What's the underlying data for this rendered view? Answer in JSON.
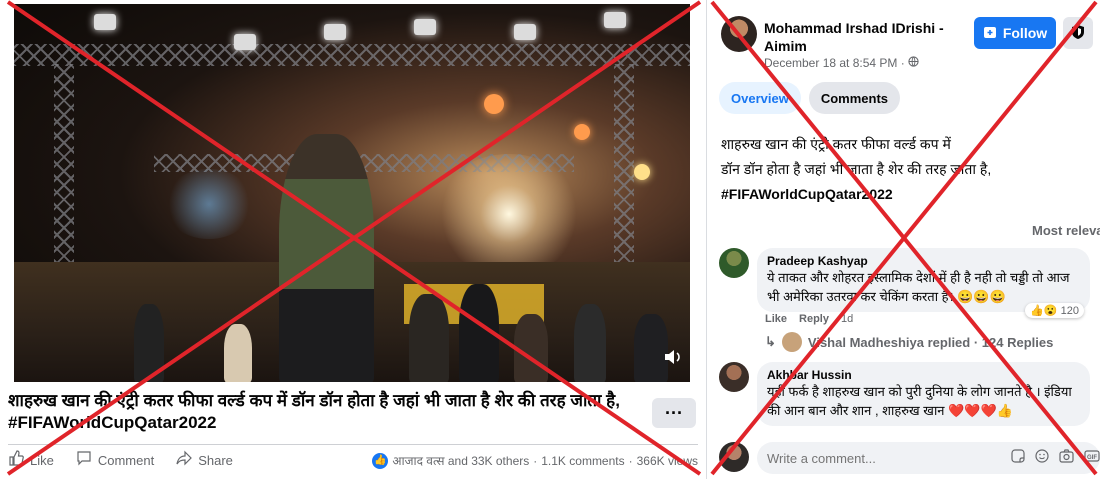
{
  "video_post": {
    "title": "शाहरुख खान की एंट्री कतर फीफा वर्ल्ड कप में डॉन डॉन होता है जहां भी जाता है शेर की तरह जाता है, #FIFAWorldCupQatar2022",
    "more_label": "···",
    "actions": {
      "like": "Like",
      "comment": "Comment",
      "share": "Share"
    },
    "stats": {
      "reactions": "आजाद वत्स and 33K others",
      "separator": "·",
      "comments": "1.1K comments",
      "views": "366K views"
    }
  },
  "post_detail": {
    "author": "Mohammad Irshad IDrishi - Aimim",
    "timestamp": "December 18 at 8:54 PM ·",
    "follow_label": "Follow",
    "tabs": [
      {
        "label": "Overview",
        "active": true
      },
      {
        "label": "Comments",
        "active": false
      }
    ],
    "caption_lines": [
      "शाहरुख खान की एंट्री कतर फीफा वर्ल्ड कप में",
      "डॉन डॉन होता है जहां भी जाता है शेर की तरह जाता है,",
      "#FIFAWorldCupQatar2022"
    ],
    "sort_label": "Most releva",
    "comments": [
      {
        "author": "Pradeep Kashyap",
        "text": "ये ताकत और शोहरत इस्लामिक देशों में ही है नही तो चड्डी तो आज भी अमेरिका उतरवा कर चेकिंग करता है। 😀😀😀",
        "like": "Like",
        "reply": "Reply",
        "time": "1d",
        "reaction_count": "120",
        "replies": "Vishal Madheshiya replied · 124 Replies"
      },
      {
        "author": "Akhbar Hussin",
        "text": "यही फर्क है शाहरुख खान को पुरी दुनिया के लोग जानते है । इंडिया की आन बान और शान , शाहरुख खान ❤️❤️❤️👍"
      }
    ],
    "write_placeholder": "Write a comment..."
  },
  "colors": {
    "accent": "#1877f2",
    "x_mark": "#e0242a",
    "bubble": "#f0f2f5",
    "muted_text": "#65676b"
  },
  "icons": [
    "like-icon",
    "comment-icon",
    "share-icon",
    "shield-icon",
    "globe-icon",
    "volume-icon",
    "sticker-icon",
    "emoji-icon",
    "camera-icon",
    "gif-icon"
  ]
}
